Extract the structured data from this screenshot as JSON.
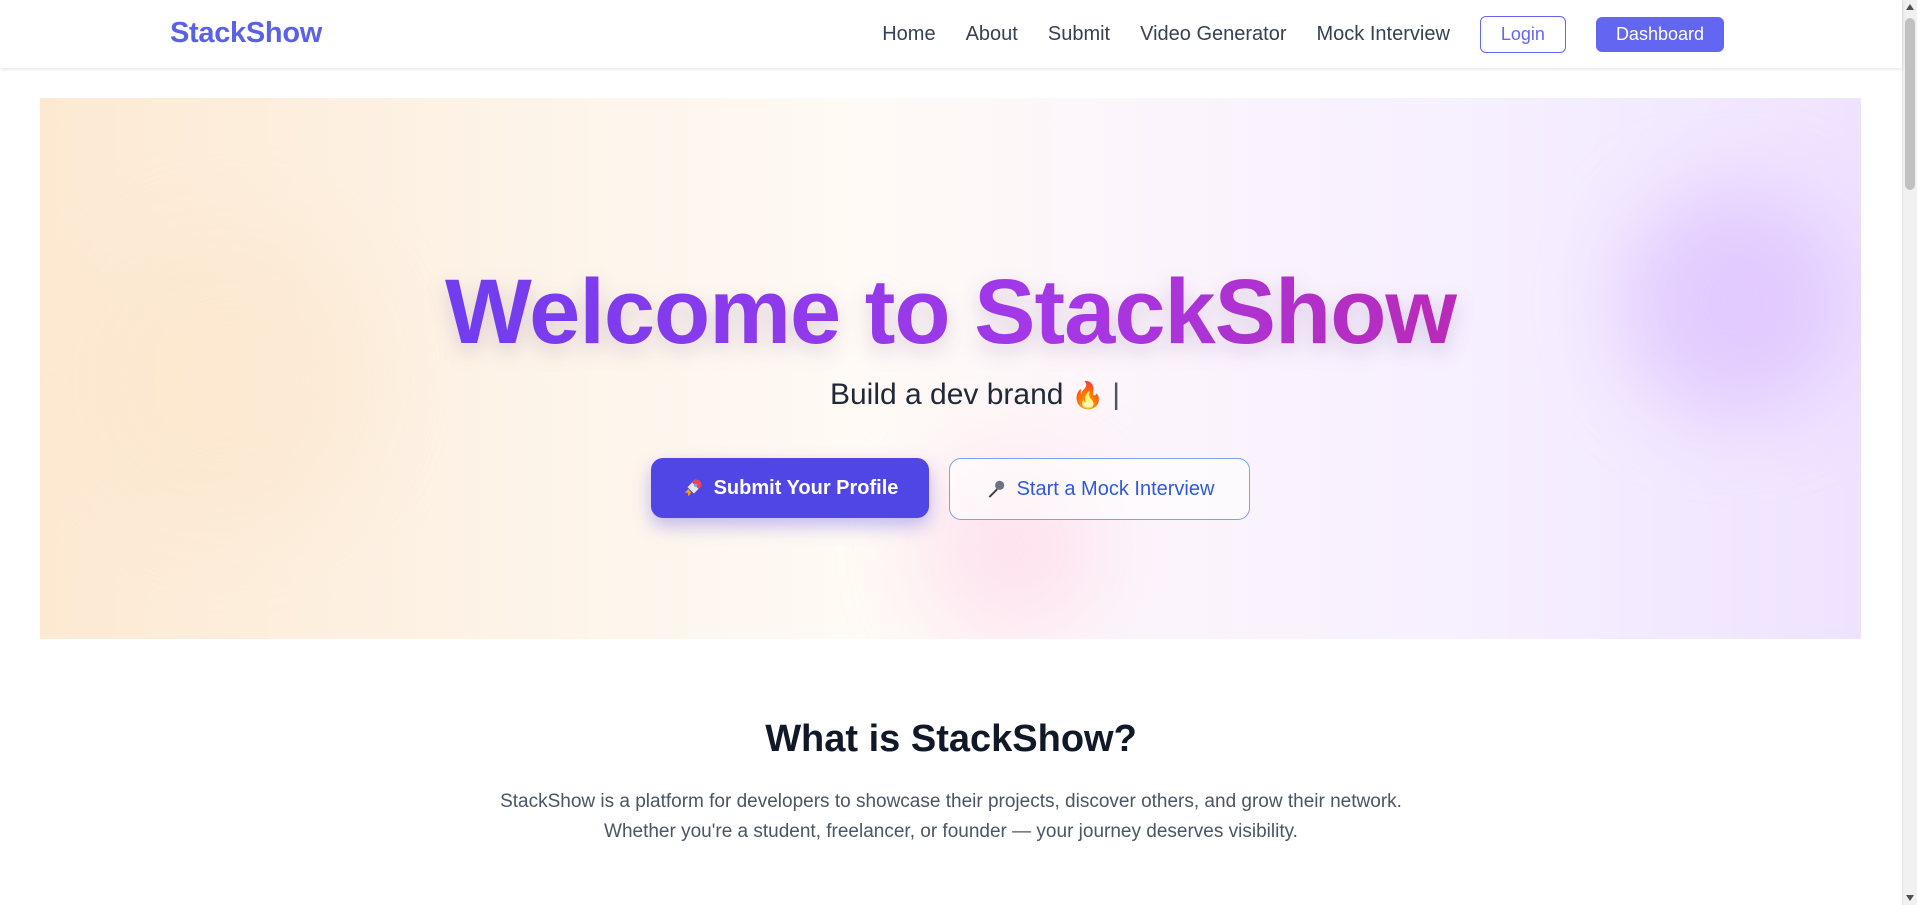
{
  "navbar": {
    "brand": "StackShow",
    "links": [
      "Home",
      "About",
      "Submit",
      "Video Generator",
      "Mock Interview"
    ],
    "login_label": "Login",
    "dashboard_label": "Dashboard"
  },
  "hero": {
    "title": "Welcome to StackShow",
    "subtitle": "Build a dev brand",
    "subtitle_emoji": "🔥",
    "cursor": "|",
    "primary_button": "Submit Your Profile",
    "primary_icon": "rocket-icon",
    "secondary_button": "Start a Mock Interview",
    "secondary_icon": "microphone-icon"
  },
  "about": {
    "title": "What is StackShow?",
    "line1": "StackShow is a platform for developers to showcase their projects, discover others, and grow their network.",
    "line2": "Whether you're a student, freelancer, or founder — your journey deserves visibility."
  },
  "colors": {
    "brand": "#5b61e6",
    "primary_button": "#4f46e5",
    "secondary_text": "#2e5ad8",
    "title_gradient_start": "#6d3df0",
    "title_gradient_end": "#c026a8"
  }
}
